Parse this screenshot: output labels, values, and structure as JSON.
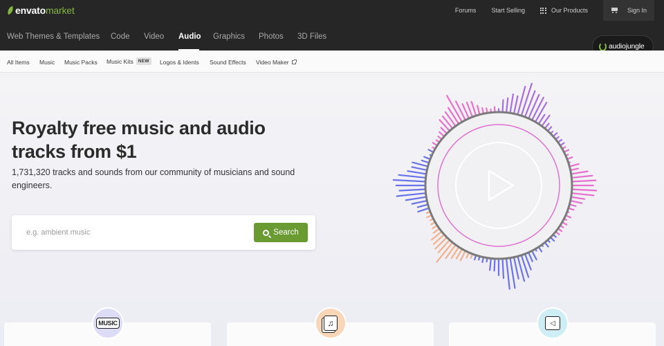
{
  "topbar": {
    "logo_brand": "envato",
    "logo_suffix": "market",
    "links": [
      "Forums",
      "Start Selling",
      "Our Products"
    ],
    "signin": "Sign In"
  },
  "catnav": {
    "items": [
      "Web Themes & Templates",
      "Code",
      "Video",
      "Audio",
      "Graphics",
      "Photos",
      "3D Files"
    ],
    "active": "Audio",
    "badge": "audiojungle"
  },
  "subnav": {
    "items": [
      "All Items",
      "Music",
      "Music Packs",
      "Music Kits",
      "Logos & Idents",
      "Sound Effects",
      "Video Maker"
    ],
    "new_tag": "NEW"
  },
  "hero": {
    "headline": "Royalty free music and audio tracks from $1",
    "subline": "1,731,320 tracks and sounds from our community of musicians and sound engineers.",
    "search_placeholder": "e.g. ambient music",
    "search_button": "Search"
  },
  "cards": [
    {
      "icon_label": "MUSIC",
      "icon": "music-tag-icon",
      "bg": "#dcdcf6"
    },
    {
      "icon": "music-pack-icon",
      "bg": "#f9d6b8"
    },
    {
      "icon": "speaker-icon",
      "bg": "#cdeef4"
    }
  ],
  "colors": {
    "accent": "#82b541",
    "search_button": "#6a9a32",
    "topbar": "#262626",
    "viz_pink": "#e86fcf",
    "viz_purple": "#a86de0",
    "viz_blue": "#6a73e8",
    "viz_peach": "#f4b08a"
  }
}
